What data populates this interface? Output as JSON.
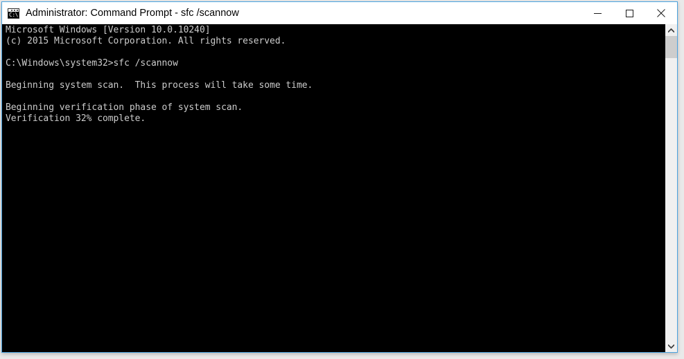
{
  "window": {
    "title": "Administrator: Command Prompt - sfc  /scannow",
    "icon": "cmd-console-icon",
    "icon_prompt_text": "C:\\",
    "border_color": "#4aa3e0",
    "titlebar_background": "#ffffff",
    "controls": {
      "minimize_label": "Minimize",
      "maximize_label": "Maximize",
      "close_label": "Close"
    }
  },
  "console": {
    "background_color": "#000000",
    "text_color": "#cccccc",
    "lines": [
      "Microsoft Windows [Version 10.0.10240]",
      "(c) 2015 Microsoft Corporation. All rights reserved.",
      "",
      "C:\\Windows\\system32>sfc /scannow",
      "",
      "Beginning system scan.  This process will take some time.",
      "",
      "Beginning verification phase of system scan.",
      "Verification 32% complete.",
      ""
    ],
    "text": "Microsoft Windows [Version 10.0.10240]\n(c) 2015 Microsoft Corporation. All rights reserved.\n\nC:\\Windows\\system32>sfc /scannow\n\nBeginning system scan.  This process will take some time.\n\nBeginning verification phase of system scan.\nVerification 32% complete.\n",
    "command": "sfc /scannow",
    "prompt": "C:\\Windows\\system32>",
    "windows_version": "10.0.10240",
    "copyright_year": "2015",
    "verification_percent": "32%"
  },
  "scrollbar": {
    "track_color": "#f0f0f0",
    "thumb_color": "#cdcdcd",
    "up_arrow_label": "Scroll up",
    "down_arrow_label": "Scroll down"
  }
}
